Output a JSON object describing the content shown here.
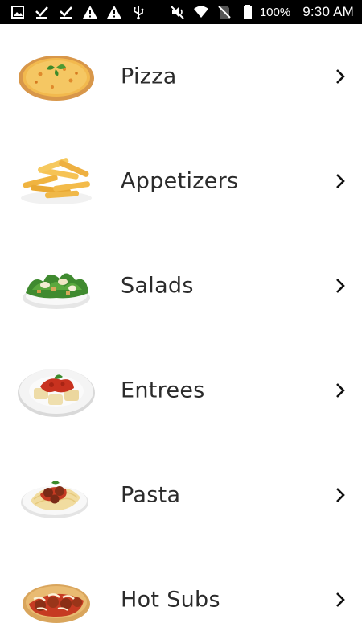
{
  "status_bar": {
    "left_icons": [
      "image-icon",
      "check-download-icon",
      "check-download-icon",
      "warning-icon",
      "warning-icon",
      "usb-icon"
    ],
    "right_icons": [
      "mute-icon",
      "wifi-icon",
      "no-sim-icon",
      "battery-icon"
    ],
    "battery_percent": "100%",
    "time": "9:30 AM"
  },
  "menu": {
    "items": [
      {
        "label": "Pizza",
        "icon": "pizza-thumbnail"
      },
      {
        "label": "Appetizers",
        "icon": "fries-thumbnail"
      },
      {
        "label": "Salads",
        "icon": "salad-thumbnail"
      },
      {
        "label": "Entrees",
        "icon": "ravioli-thumbnail"
      },
      {
        "label": "Pasta",
        "icon": "spaghetti-thumbnail"
      },
      {
        "label": "Hot Subs",
        "icon": "meatball-sub-thumbnail"
      }
    ],
    "chevron_icon": "chevron-right-icon"
  },
  "colors": {
    "status_bar_bg": "#000000",
    "page_bg": "#ffffff",
    "label_text": "#2b2b2b"
  }
}
